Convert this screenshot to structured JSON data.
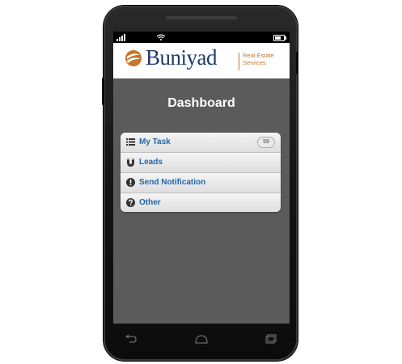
{
  "device": {
    "frame_color": "#121212",
    "screen_bg": "#5b5b5b"
  },
  "statusbar": {
    "icons": [
      "signal-icon",
      "wifi-icon",
      "battery-icon"
    ]
  },
  "header": {
    "logo_text": "Buniyad",
    "tagline_line1": "Real Estate",
    "tagline_line2": "Services",
    "brand_colors": {
      "blue": "#1f3c6b",
      "orange": "#c8762b"
    }
  },
  "page": {
    "title": "Dashboard"
  },
  "menu": {
    "items": [
      {
        "label": "My Task",
        "icon": "list-icon",
        "badge": "59"
      },
      {
        "label": "Leads",
        "icon": "magnet-icon"
      },
      {
        "label": "Send Notification",
        "icon": "alert-icon"
      },
      {
        "label": "Other",
        "icon": "help-icon"
      }
    ],
    "label_color": "#2166a6"
  },
  "navbar": {
    "icons": [
      "back-icon",
      "home-icon",
      "recent-apps-icon"
    ]
  }
}
